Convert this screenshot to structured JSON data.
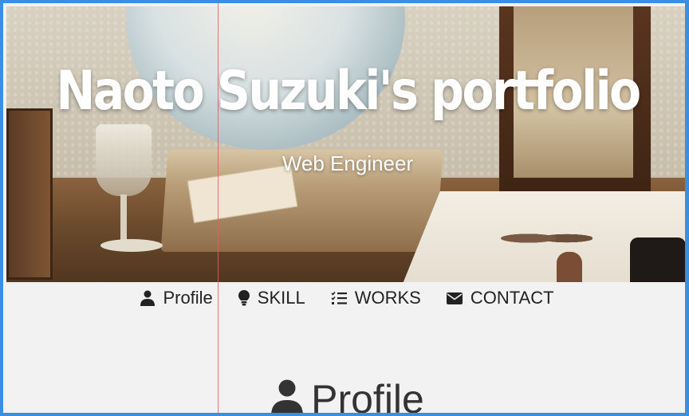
{
  "hero": {
    "title": "Naoto Suzuki's portfolio",
    "subtitle": "Web Engineer"
  },
  "nav": {
    "items": [
      {
        "label": "Profile",
        "icon": "user-icon"
      },
      {
        "label": "SKILL",
        "icon": "lightbulb-icon"
      },
      {
        "label": "WORKS",
        "icon": "checklist-icon"
      },
      {
        "label": "CONTACT",
        "icon": "envelope-icon"
      }
    ]
  },
  "section": {
    "title": "Profile",
    "icon": "user-icon"
  },
  "colors": {
    "frame_border": "#3b8fe0",
    "guide_line": "#e06060",
    "background": "#f2f2f2",
    "nav_text": "#222222"
  }
}
